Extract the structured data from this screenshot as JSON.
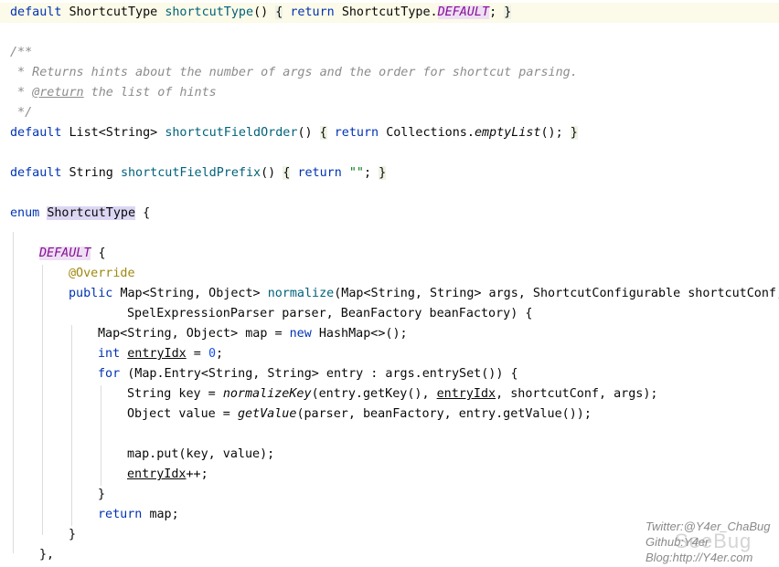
{
  "editor": {
    "line1": {
      "kw": "default",
      "type": "ShortcutType",
      "fn": "shortcutType",
      "paren": "()",
      "brace_open": "{",
      "ret": "return",
      "cls": "ShortcutType.",
      "const": "DEFAULT",
      "semi": ";",
      "brace_close": "}"
    },
    "doc": {
      "open": "/**",
      "desc": " * Returns hints about the number of args and the order for shortcut parsing.",
      "star": " * ",
      "tag": "@return",
      "tag_text": " the list of hints",
      "close": " */"
    },
    "line7": {
      "kw": "default",
      "type": "List<String>",
      "fn": "shortcutFieldOrder",
      "paren": "()",
      "brace_open": "{",
      "ret": "return",
      "cls": "Collections.",
      "method": "emptyList",
      "tail": "();",
      "brace_close": "}"
    },
    "line9": {
      "kw": "default",
      "type": "String",
      "fn": "shortcutFieldPrefix",
      "paren": "()",
      "brace_open": "{",
      "ret": "return",
      "str": "\"\"",
      "semi": ";",
      "brace_close": "}"
    },
    "line11": {
      "kw": "enum",
      "name": "ShortcutType",
      "brace": "{"
    },
    "line13": {
      "const": "DEFAULT",
      "brace": "{"
    },
    "line14": {
      "ann": "@Override"
    },
    "line15": {
      "kw": "public",
      "type": "Map<String, Object>",
      "fn": "normalize",
      "params": "(Map<String, String> args, ShortcutConfigurable shortcutConf,"
    },
    "line16": {
      "params": "SpelExpressionParser parser, BeanFactory beanFactory) {"
    },
    "line17": {
      "a": "Map<String, Object> map = ",
      "kw": "new",
      "b": "HashMap<>();"
    },
    "line18": {
      "kw": "int",
      "var": "entryIdx",
      "eq": " = ",
      "num": "0",
      "semi": ";"
    },
    "line19": {
      "kw": "for",
      "rest": "(Map.Entry<String, String> entry : args.entrySet()) {"
    },
    "line20": {
      "a": "String key = ",
      "method": "normalizeKey",
      "b": "(entry.getKey(), ",
      "var": "entryIdx",
      "c": ", shortcutConf, args);"
    },
    "line21": {
      "a": "Object value = ",
      "method": "getValue",
      "b": "(parser, beanFactory, entry.getValue());"
    },
    "line23": {
      "text": "map.put(key, value);"
    },
    "line24": {
      "var": "entryIdx",
      "tail": "++;"
    },
    "line25": {
      "text": "}"
    },
    "line26": {
      "kw": "return",
      "tail": "map;"
    },
    "line27": {
      "text": "}"
    },
    "line28": {
      "text": "},"
    }
  },
  "watermark": {
    "twitter": "Twitter:@Y4er_ChaBug",
    "github": "Github:Y4er",
    "blog": "Blog:http://Y4er.com",
    "logo": "SeeBug"
  }
}
